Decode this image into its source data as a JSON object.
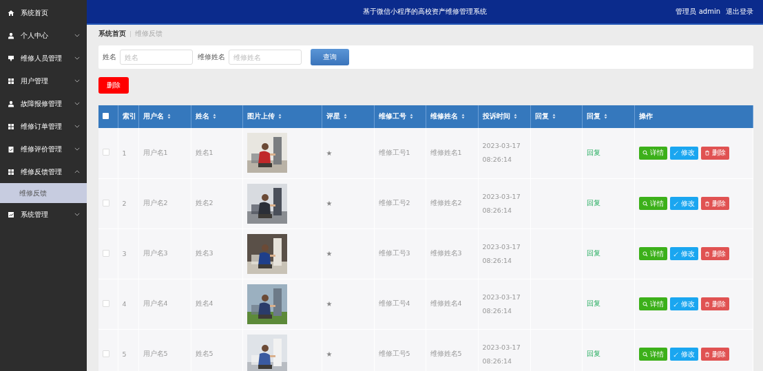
{
  "header": {
    "title": "基于微信小程序的高校资产维修管理系统",
    "user": "管理员 admin",
    "logout": "退出登录"
  },
  "sidebar": [
    {
      "label": "系统首页",
      "has_arrow": false
    },
    {
      "label": "个人中心",
      "expanded": false,
      "has_arrow": true
    },
    {
      "label": "维修人员管理",
      "expanded": false,
      "has_arrow": true
    },
    {
      "label": "用户管理",
      "expanded": false,
      "has_arrow": true
    },
    {
      "label": "故障报修管理",
      "expanded": false,
      "has_arrow": true
    },
    {
      "label": "维修订单管理",
      "expanded": false,
      "has_arrow": true
    },
    {
      "label": "维修评价管理",
      "expanded": false,
      "has_arrow": true
    },
    {
      "label": "维修反馈管理",
      "expanded": true,
      "has_arrow": true,
      "children": [
        {
          "label": "维修反馈",
          "selected": true
        }
      ]
    },
    {
      "label": "系统管理",
      "expanded": false,
      "has_arrow": true
    }
  ],
  "breadcrumb": [
    "系统首页",
    "维修反馈"
  ],
  "search": {
    "fields": [
      {
        "label": "姓名",
        "placeholder": "姓名"
      },
      {
        "label": "维修姓名",
        "placeholder": "维修姓名"
      }
    ],
    "button": "查询"
  },
  "delete_button": "删除",
  "table": {
    "select_all": false,
    "columns": [
      {
        "label": "索引"
      },
      {
        "label": "用户名",
        "sortable": true
      },
      {
        "label": "姓名",
        "sortable": true
      },
      {
        "label": "图片上传",
        "sortable": true
      },
      {
        "label": "评星",
        "sortable": true
      },
      {
        "label": "维修工号",
        "sortable": true
      },
      {
        "label": "维修姓名",
        "sortable": true
      },
      {
        "label": "投诉时间",
        "sortable": true
      },
      {
        "label": "回复",
        "sortable": true
      },
      {
        "label": "回复",
        "sortable": true
      },
      {
        "label": "操作"
      }
    ],
    "rows": [
      {
        "checked": false,
        "index": "1",
        "username": "用户名1",
        "name": "姓名1",
        "rating": "★",
        "job_no": "维修工号1",
        "repair_name": "维修姓名1",
        "time": "2023-03-17 08:26:14",
        "reply_link": "回复",
        "actions": [
          "详情",
          "修改",
          "删除"
        ]
      },
      {
        "checked": false,
        "index": "2",
        "username": "用户名2",
        "name": "姓名2",
        "rating": "★",
        "job_no": "维修工号2",
        "repair_name": "维修姓名2",
        "time": "2023-03-17 08:26:14",
        "reply_link": "回复",
        "actions": [
          "详情",
          "修改",
          "删除"
        ]
      },
      {
        "checked": false,
        "index": "3",
        "username": "用户名3",
        "name": "姓名3",
        "rating": "★",
        "job_no": "维修工号3",
        "repair_name": "维修姓名3",
        "time": "2023-03-17 08:26:14",
        "reply_link": "回复",
        "actions": [
          "详情",
          "修改",
          "删除"
        ]
      },
      {
        "checked": false,
        "index": "4",
        "username": "用户名4",
        "name": "姓名4",
        "rating": "★",
        "job_no": "维修工号4",
        "repair_name": "维修姓名4",
        "time": "2023-03-17 08:26:14",
        "reply_link": "回复",
        "actions": [
          "详情",
          "修改",
          "删除"
        ]
      },
      {
        "checked": false,
        "index": "5",
        "username": "用户名5",
        "name": "姓名5",
        "rating": "★",
        "job_no": "维修工号5",
        "repair_name": "维修姓名5",
        "time": "2023-03-17 08:26:14",
        "reply_link": "回复",
        "actions": [
          "详情",
          "修改",
          "删除"
        ]
      }
    ]
  }
}
